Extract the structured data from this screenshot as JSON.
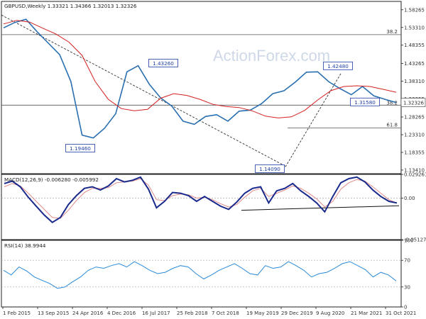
{
  "watermark": "ActionForex.com",
  "price_panel": {
    "title": "GBPUSD,Weekly  1.33321 1.34366 1.32013 1.32326",
    "last_value_label": "1.32326"
  },
  "macd_panel": {
    "title": "MACD(12,26,9) -0.006280 -0.005992"
  },
  "rsi_panel": {
    "title": "RSI(14) 38.9944"
  },
  "chart_data": [
    {
      "type": "line",
      "title": "GBPUSD,Weekly  1.33321 1.34366 1.32013 1.32326",
      "x": [
        "1 Feb 2015",
        "13 Sep 2015",
        "24 Apr 2016",
        "4 Dec 2016",
        "16 Jul 2017",
        "25 Feb 2018",
        "7 Oct 2018",
        "19 May 2019",
        "29 Dec 2019",
        "9 Aug 2020",
        "21 Mar 2021",
        "31 Oct 2021"
      ],
      "yticks": [
        "1.58265",
        "1.53310",
        "1.48355",
        "1.43265",
        "1.38310",
        "1.33355",
        "1.28265",
        "1.23310",
        "1.18355",
        "1.13410"
      ],
      "ylim": [
        1.124,
        1.606
      ],
      "series": [
        {
          "values": [
            1.532,
            1.547,
            1.556,
            1.521,
            1.489,
            1.457,
            1.382,
            1.232,
            1.224,
            1.251,
            1.292,
            1.409,
            1.426,
            1.374,
            1.336,
            1.313,
            1.271,
            1.262,
            1.284,
            1.289,
            1.271,
            1.299,
            1.302,
            1.32,
            1.348,
            1.356,
            1.38,
            1.408,
            1.409,
            1.381,
            1.362,
            1.345,
            1.368,
            1.342,
            1.332,
            1.323
          ]
        },
        {
          "values": [
            1.543,
            1.553,
            1.548,
            1.531,
            1.515,
            1.492,
            1.455,
            1.382,
            1.332,
            1.306,
            1.3,
            1.304,
            1.335,
            1.348,
            1.343,
            1.332,
            1.318,
            1.312,
            1.309,
            1.3,
            1.285,
            1.28,
            1.283,
            1.301,
            1.33,
            1.356,
            1.368,
            1.37,
            1.368,
            1.36,
            1.352
          ]
        }
      ],
      "annotations": [
        {
          "label": "38.2",
          "value": 1.513
        },
        {
          "label": "38.2",
          "value": 1.3158
        },
        {
          "label": "61.8",
          "value": 1.252
        },
        {
          "label": "1.43260",
          "value": 1.4326
        },
        {
          "label": "1.19460",
          "value": 1.1946
        },
        {
          "label": "1.14090",
          "value": 1.1409
        },
        {
          "label": "1.42480",
          "value": 1.4248
        },
        {
          "label": "1.31580",
          "value": 1.3158
        }
      ],
      "grid": false
    },
    {
      "type": "line",
      "title": "MACD(12,26,9) -0.006280 -0.005992",
      "yticks": [
        "0.029261",
        "0.00",
        "-0.051279"
      ],
      "ylim": [
        -0.0513,
        0.0293
      ],
      "series": [
        {
          "values": [
            0.018,
            0.021,
            0.014,
            0.001,
            -0.01,
            -0.021,
            -0.03,
            -0.024,
            -0.008,
            0.003,
            0.012,
            0.014,
            0.01,
            0.015,
            0.024,
            0.02,
            0.022,
            0.026,
            0.011,
            -0.012,
            -0.004,
            0.007,
            0.006,
            0.003,
            -0.004,
            0.002,
            -0.004,
            -0.01,
            -0.014,
            -0.005,
            0.006,
            0.012,
            0.014,
            -0.006,
            0.009,
            0.012,
            0.018,
            0.009,
            0.002,
            -0.006,
            -0.017,
            0.002,
            0.019,
            0.024,
            0.026,
            0.02,
            0.01,
            0.002,
            -0.004,
            -0.006
          ]
        },
        {
          "values": [
            0.014,
            0.018,
            0.015,
            0.006,
            -0.004,
            -0.014,
            -0.024,
            -0.025,
            -0.015,
            -0.003,
            0.007,
            0.012,
            0.012,
            0.013,
            0.019,
            0.02,
            0.021,
            0.024,
            0.016,
            -0.002,
            -0.003,
            0.003,
            0.005,
            0.004,
            0.0,
            0.001,
            -0.002,
            -0.007,
            -0.011,
            -0.008,
            0.001,
            0.009,
            0.012,
            0.002,
            0.006,
            0.01,
            0.015,
            0.012,
            0.006,
            -0.001,
            -0.011,
            -0.004,
            0.011,
            0.019,
            0.023,
            0.021,
            0.014,
            0.006,
            -0.002,
            -0.006
          ]
        }
      ],
      "grid": false
    },
    {
      "type": "line",
      "title": "RSI(14) 38.9944",
      "yticks": [
        "100",
        "70",
        "30",
        "0"
      ],
      "ylim": [
        0,
        100
      ],
      "series": [
        {
          "values": [
            55,
            48,
            60,
            54,
            45,
            40,
            35,
            28,
            30,
            38,
            45,
            55,
            60,
            58,
            62,
            65,
            60,
            68,
            62,
            55,
            50,
            52,
            58,
            62,
            60,
            50,
            42,
            48,
            55,
            60,
            65,
            58,
            50,
            48,
            62,
            58,
            60,
            68,
            62,
            55,
            45,
            50,
            52,
            58,
            65,
            68,
            62,
            56,
            45,
            52,
            48,
            39
          ]
        }
      ],
      "grid": false
    }
  ]
}
